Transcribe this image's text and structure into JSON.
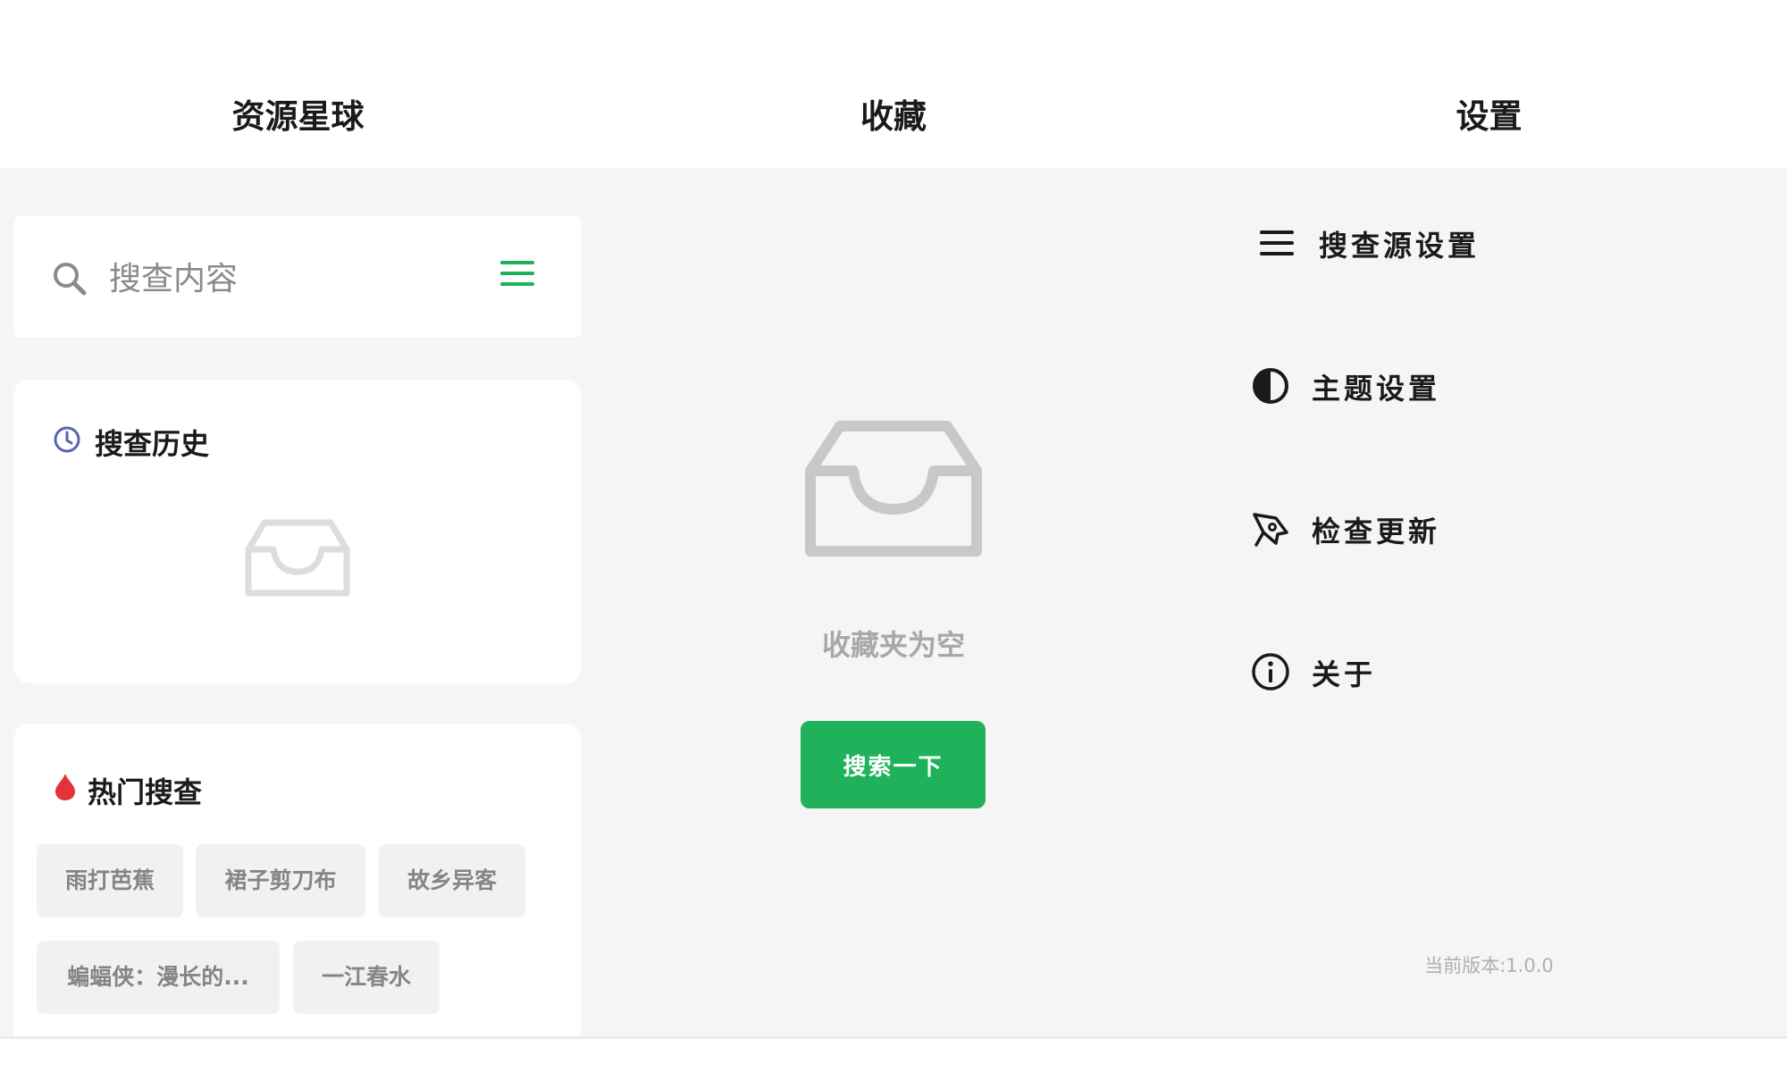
{
  "panels": {
    "resources": {
      "title": "资源星球",
      "search": {
        "placeholder": "搜查内容"
      },
      "history": {
        "title": "搜查历史"
      },
      "hot": {
        "title": "热门搜查",
        "tags": [
          "雨打芭蕉",
          "裙子剪刀布",
          "故乡异客",
          "蝙蝠侠：漫长的...",
          "一江春水"
        ]
      }
    },
    "favorites": {
      "title": "收藏",
      "empty_text": "收藏夹为空",
      "button_label": "搜索一下"
    },
    "settings": {
      "title": "设置",
      "items": [
        {
          "label": "搜查源设置",
          "icon": "menu-icon"
        },
        {
          "label": "主题设置",
          "icon": "contrast-icon"
        },
        {
          "label": "检查更新",
          "icon": "rocket-icon"
        },
        {
          "label": "关于",
          "icon": "info-icon"
        }
      ],
      "version": "当前版本:1.0.0"
    }
  },
  "colors": {
    "accent_green": "#1fb25a",
    "history_icon": "#5c63b3",
    "hot_icon": "#e0343a",
    "background": "#f5f5f5"
  }
}
